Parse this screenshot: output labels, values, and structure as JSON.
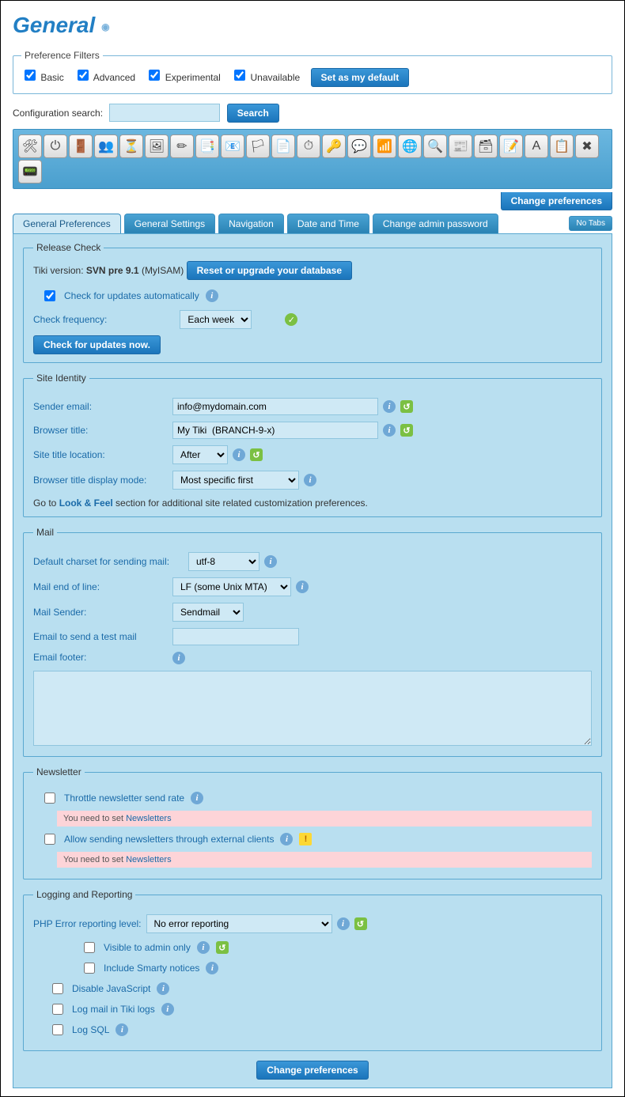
{
  "title": "General",
  "filters": {
    "legend": "Preference Filters",
    "items": [
      "Basic",
      "Advanced",
      "Experimental",
      "Unavailable"
    ],
    "set_default": "Set as my default"
  },
  "search": {
    "label": "Configuration search:",
    "button": "Search",
    "value": ""
  },
  "toolbar_icons": [
    "🛠",
    "⏻",
    "🚪",
    "👥",
    "⏳",
    "🖼",
    "✏",
    "📑",
    "📧",
    "🏳",
    "📄",
    "⏱",
    "🔑",
    "💬",
    "📶",
    "🌐",
    "🔍",
    "📰",
    "🗃",
    "📝",
    "A",
    "📋",
    "✖",
    "📟"
  ],
  "change_prefs": "Change preferences",
  "tabs": [
    "General Preferences",
    "General Settings",
    "Navigation",
    "Date and Time",
    "Change admin password"
  ],
  "no_tabs": "No Tabs",
  "release": {
    "legend": "Release Check",
    "version_prefix": "Tiki version: ",
    "version_bold": "SVN pre 9.1",
    "version_suffix": " (MyISAM)",
    "reset_db": "Reset or upgrade your database",
    "auto_check": "Check for updates automatically",
    "freq_label": "Check frequency:",
    "freq_value": "Each week",
    "check_now": "Check for updates now."
  },
  "identity": {
    "legend": "Site Identity",
    "sender_label": "Sender email:",
    "sender_value": "info@mydomain.com",
    "browser_title_label": "Browser title:",
    "browser_title_value": "My Tiki  (BRANCH-9-x)",
    "title_loc_label": "Site title location:",
    "title_loc_value": "After",
    "display_mode_label": "Browser title display mode:",
    "display_mode_value": "Most specific first",
    "goto_prefix": "Go to ",
    "goto_link": "Look & Feel",
    "goto_suffix": " section for additional site related customization preferences."
  },
  "mail": {
    "legend": "Mail",
    "charset_label": "Default charset for sending mail:",
    "charset_value": "utf-8",
    "eol_label": "Mail end of line:",
    "eol_value": "LF (some Unix MTA)",
    "sender_label": "Mail Sender:",
    "sender_value": "Sendmail",
    "test_label": "Email to send a test mail",
    "test_value": "",
    "footer_label": "Email footer:",
    "footer_value": ""
  },
  "newsletter": {
    "legend": "Newsletter",
    "throttle": "Throttle newsletter send rate",
    "warn_prefix": "You need to set ",
    "warn_link": "Newsletters",
    "external": "Allow sending newsletters through external clients"
  },
  "logging": {
    "legend": "Logging and Reporting",
    "php_label": "PHP Error reporting level:",
    "php_value": "No error reporting",
    "visible_admin": "Visible to admin only",
    "smarty": "Include Smarty notices",
    "disable_js": "Disable JavaScript",
    "log_mail": "Log mail in Tiki logs",
    "log_sql": "Log SQL"
  }
}
